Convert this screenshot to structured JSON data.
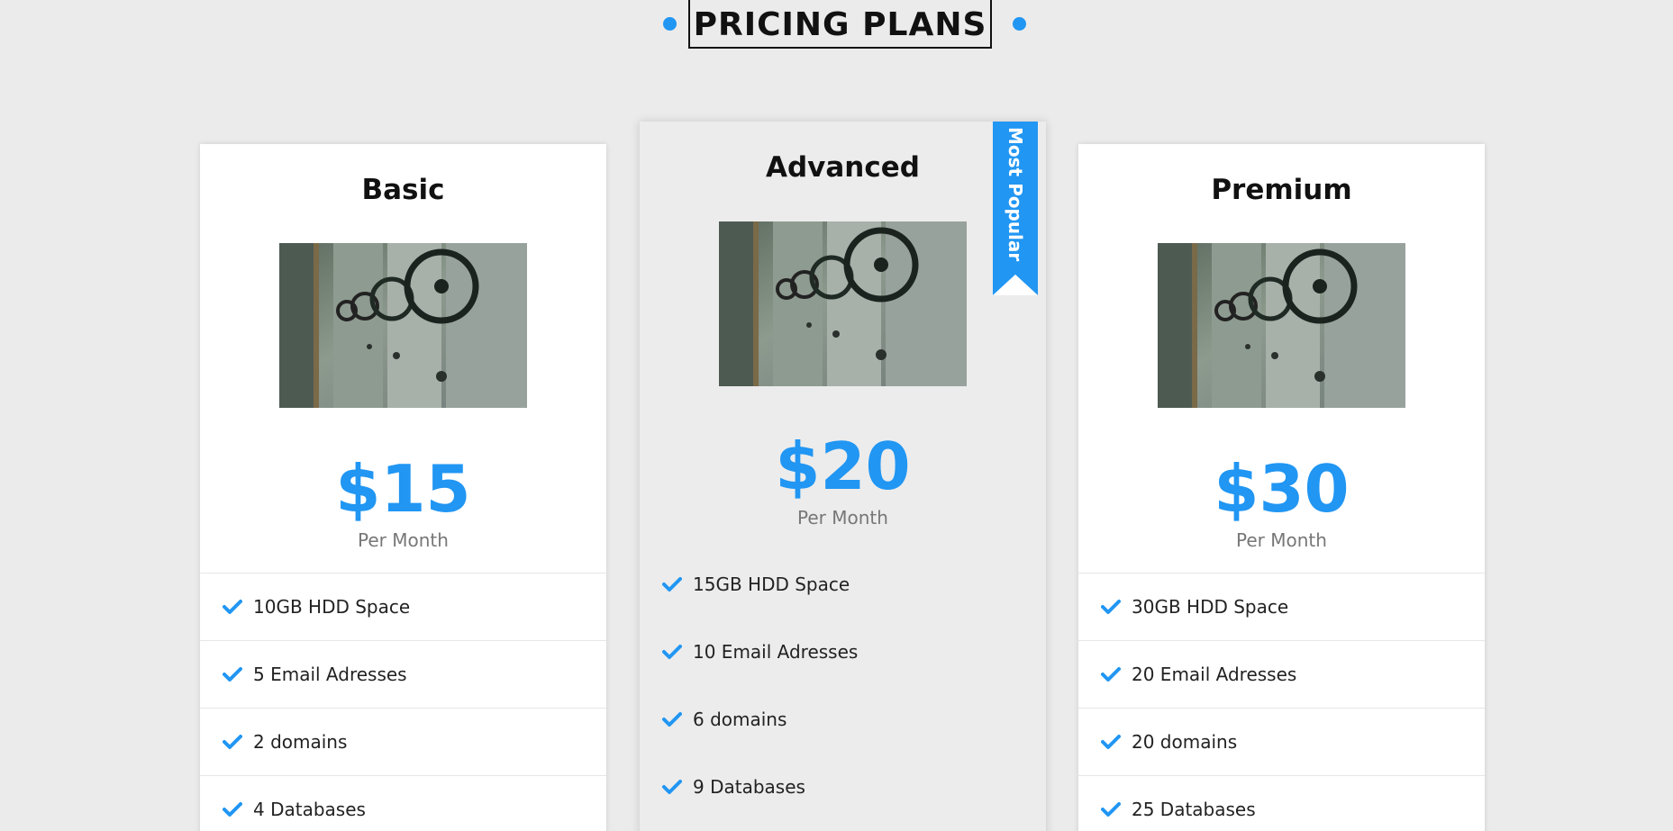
{
  "section": {
    "title": "PRICING PLANS"
  },
  "colors": {
    "accent": "#2196f3",
    "page_background": "#ebebeb",
    "card_background": "#ffffff",
    "featured_background": "#ececec"
  },
  "plans": [
    {
      "name": "Basic",
      "price": "$15",
      "period": "Per Month",
      "image_icon": "vault-doors-image",
      "features": [
        "10GB HDD Space",
        "5 Email Adresses",
        "2 domains",
        "4 Databases"
      ]
    },
    {
      "name": "Advanced",
      "price": "$20",
      "period": "Per Month",
      "badge": "Most Popular",
      "image_icon": "vault-doors-image",
      "features": [
        "15GB HDD Space",
        "10 Email Adresses",
        "6 domains",
        "9 Databases"
      ]
    },
    {
      "name": "Premium",
      "price": "$30",
      "period": "Per Month",
      "image_icon": "vault-doors-image",
      "features": [
        "30GB HDD Space",
        "20 Email Adresses",
        "20 domains",
        "25 Databases"
      ]
    }
  ]
}
